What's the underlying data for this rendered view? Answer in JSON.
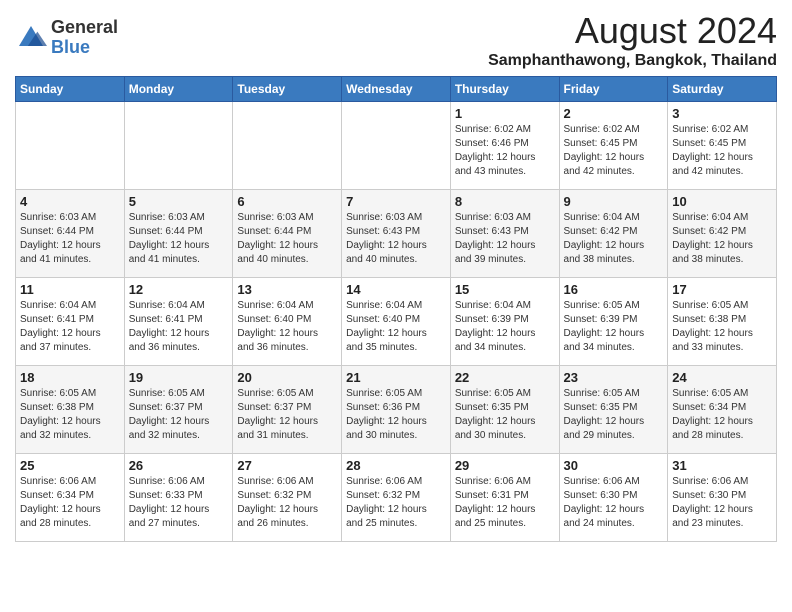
{
  "logo": {
    "general": "General",
    "blue": "Blue"
  },
  "title": "August 2024",
  "location": "Samphanthawong, Bangkok, Thailand",
  "days_of_week": [
    "Sunday",
    "Monday",
    "Tuesday",
    "Wednesday",
    "Thursday",
    "Friday",
    "Saturday"
  ],
  "weeks": [
    [
      {
        "day": "",
        "info": ""
      },
      {
        "day": "",
        "info": ""
      },
      {
        "day": "",
        "info": ""
      },
      {
        "day": "",
        "info": ""
      },
      {
        "day": "1",
        "info": "Sunrise: 6:02 AM\nSunset: 6:46 PM\nDaylight: 12 hours\nand 43 minutes."
      },
      {
        "day": "2",
        "info": "Sunrise: 6:02 AM\nSunset: 6:45 PM\nDaylight: 12 hours\nand 42 minutes."
      },
      {
        "day": "3",
        "info": "Sunrise: 6:02 AM\nSunset: 6:45 PM\nDaylight: 12 hours\nand 42 minutes."
      }
    ],
    [
      {
        "day": "4",
        "info": "Sunrise: 6:03 AM\nSunset: 6:44 PM\nDaylight: 12 hours\nand 41 minutes."
      },
      {
        "day": "5",
        "info": "Sunrise: 6:03 AM\nSunset: 6:44 PM\nDaylight: 12 hours\nand 41 minutes."
      },
      {
        "day": "6",
        "info": "Sunrise: 6:03 AM\nSunset: 6:44 PM\nDaylight: 12 hours\nand 40 minutes."
      },
      {
        "day": "7",
        "info": "Sunrise: 6:03 AM\nSunset: 6:43 PM\nDaylight: 12 hours\nand 40 minutes."
      },
      {
        "day": "8",
        "info": "Sunrise: 6:03 AM\nSunset: 6:43 PM\nDaylight: 12 hours\nand 39 minutes."
      },
      {
        "day": "9",
        "info": "Sunrise: 6:04 AM\nSunset: 6:42 PM\nDaylight: 12 hours\nand 38 minutes."
      },
      {
        "day": "10",
        "info": "Sunrise: 6:04 AM\nSunset: 6:42 PM\nDaylight: 12 hours\nand 38 minutes."
      }
    ],
    [
      {
        "day": "11",
        "info": "Sunrise: 6:04 AM\nSunset: 6:41 PM\nDaylight: 12 hours\nand 37 minutes."
      },
      {
        "day": "12",
        "info": "Sunrise: 6:04 AM\nSunset: 6:41 PM\nDaylight: 12 hours\nand 36 minutes."
      },
      {
        "day": "13",
        "info": "Sunrise: 6:04 AM\nSunset: 6:40 PM\nDaylight: 12 hours\nand 36 minutes."
      },
      {
        "day": "14",
        "info": "Sunrise: 6:04 AM\nSunset: 6:40 PM\nDaylight: 12 hours\nand 35 minutes."
      },
      {
        "day": "15",
        "info": "Sunrise: 6:04 AM\nSunset: 6:39 PM\nDaylight: 12 hours\nand 34 minutes."
      },
      {
        "day": "16",
        "info": "Sunrise: 6:05 AM\nSunset: 6:39 PM\nDaylight: 12 hours\nand 34 minutes."
      },
      {
        "day": "17",
        "info": "Sunrise: 6:05 AM\nSunset: 6:38 PM\nDaylight: 12 hours\nand 33 minutes."
      }
    ],
    [
      {
        "day": "18",
        "info": "Sunrise: 6:05 AM\nSunset: 6:38 PM\nDaylight: 12 hours\nand 32 minutes."
      },
      {
        "day": "19",
        "info": "Sunrise: 6:05 AM\nSunset: 6:37 PM\nDaylight: 12 hours\nand 32 minutes."
      },
      {
        "day": "20",
        "info": "Sunrise: 6:05 AM\nSunset: 6:37 PM\nDaylight: 12 hours\nand 31 minutes."
      },
      {
        "day": "21",
        "info": "Sunrise: 6:05 AM\nSunset: 6:36 PM\nDaylight: 12 hours\nand 30 minutes."
      },
      {
        "day": "22",
        "info": "Sunrise: 6:05 AM\nSunset: 6:35 PM\nDaylight: 12 hours\nand 30 minutes."
      },
      {
        "day": "23",
        "info": "Sunrise: 6:05 AM\nSunset: 6:35 PM\nDaylight: 12 hours\nand 29 minutes."
      },
      {
        "day": "24",
        "info": "Sunrise: 6:05 AM\nSunset: 6:34 PM\nDaylight: 12 hours\nand 28 minutes."
      }
    ],
    [
      {
        "day": "25",
        "info": "Sunrise: 6:06 AM\nSunset: 6:34 PM\nDaylight: 12 hours\nand 28 minutes."
      },
      {
        "day": "26",
        "info": "Sunrise: 6:06 AM\nSunset: 6:33 PM\nDaylight: 12 hours\nand 27 minutes."
      },
      {
        "day": "27",
        "info": "Sunrise: 6:06 AM\nSunset: 6:32 PM\nDaylight: 12 hours\nand 26 minutes."
      },
      {
        "day": "28",
        "info": "Sunrise: 6:06 AM\nSunset: 6:32 PM\nDaylight: 12 hours\nand 25 minutes."
      },
      {
        "day": "29",
        "info": "Sunrise: 6:06 AM\nSunset: 6:31 PM\nDaylight: 12 hours\nand 25 minutes."
      },
      {
        "day": "30",
        "info": "Sunrise: 6:06 AM\nSunset: 6:30 PM\nDaylight: 12 hours\nand 24 minutes."
      },
      {
        "day": "31",
        "info": "Sunrise: 6:06 AM\nSunset: 6:30 PM\nDaylight: 12 hours\nand 23 minutes."
      }
    ]
  ]
}
